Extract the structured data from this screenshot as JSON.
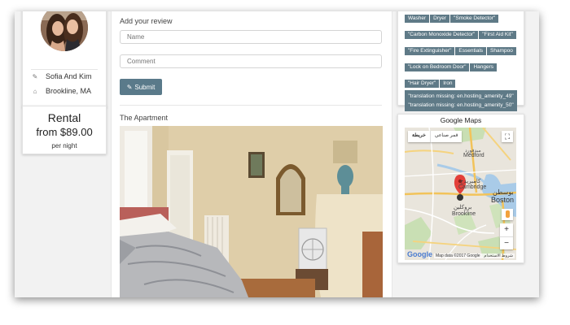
{
  "profile": {
    "host_name": "Sofia And Kim",
    "location": "Brookline, MA",
    "icons": [
      "pencil-icon",
      "home-icon"
    ]
  },
  "rental": {
    "title": "Rental",
    "price": "from $89.00",
    "unit": "per night"
  },
  "review": {
    "heading": "Add your review",
    "name_placeholder": "Name",
    "comment_placeholder": "Comment",
    "submit_label": "Submit",
    "submit_icon": "pencil-icon"
  },
  "apartment": {
    "heading": "The Apartment"
  },
  "amenities": {
    "items": [
      "Washer",
      "Dryer",
      "\"Smoke Detector\"",
      "\"Carbon Monoxide Detector\"",
      "\"First Aid Kit\"",
      "\"Fire Extinguisher\"",
      "Essentials",
      "Shampoo",
      "\"Lock on Bedroom Door\"",
      "Hangers",
      "\"Hair Dryer\"",
      "Iron"
    ],
    "missing": [
      "\"translation missing: en.hosting_amenity_49\"",
      "\"translation missing: en.hosting_amenity_50\""
    ],
    "tag_color": "#5f7a87"
  },
  "maps": {
    "title": "Google Maps",
    "btn_map": "خريطة",
    "btn_satellite": "قمر صناعي",
    "zoom_in": "+",
    "zoom_out": "−",
    "logo": "Google",
    "attribution": "Map data ©2017 Google",
    "terms": "شروط الاستخدام",
    "labels": {
      "medford": "Medford",
      "cambridge_ar": "كامبريدج",
      "cambridge": "Cambridge",
      "boston_ar": "بوسطن",
      "boston": "Boston",
      "brookline_ar": "بروكلين",
      "brookline": "Brookline",
      "medford_ar": "ميدفورد"
    },
    "road_numbers": [
      "93",
      "90",
      "1",
      "2",
      "28",
      "9",
      "3",
      "16",
      "95",
      "203",
      "128"
    ]
  }
}
